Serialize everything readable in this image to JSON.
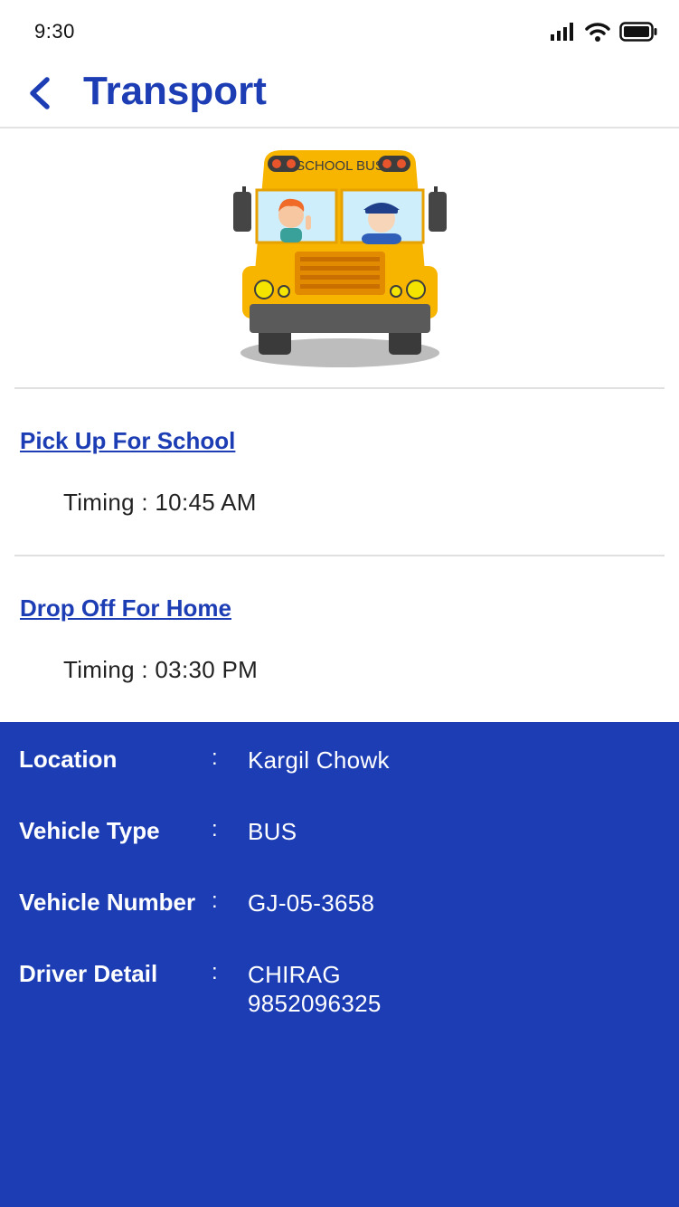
{
  "status_bar": {
    "time": "9:30",
    "icons": [
      "signal-icon",
      "wifi-icon",
      "battery-icon"
    ]
  },
  "header": {
    "back_icon": "chevron-left-icon",
    "title": "Transport"
  },
  "illustration": {
    "icon": "school-bus-illustration",
    "bus_text": "SCHOOL BUS"
  },
  "pickup": {
    "title": "Pick Up For School",
    "timing": "Timing : 10:45 AM"
  },
  "dropoff": {
    "title": "Drop Off For Home",
    "timing": "Timing : 03:30 PM"
  },
  "details": {
    "separator": ":",
    "rows": [
      {
        "label": "Location",
        "value": "Kargil Chowk"
      },
      {
        "label": "Vehicle Type",
        "value": "BUS"
      },
      {
        "label": "Vehicle Number",
        "value": "GJ-05-3658"
      },
      {
        "label": "Driver Detail",
        "value": "CHIRAG",
        "value2": "9852096325"
      }
    ]
  },
  "colors": {
    "accent": "#1c3db4",
    "bus_yellow": "#f7b500",
    "text_dark": "#222222"
  }
}
